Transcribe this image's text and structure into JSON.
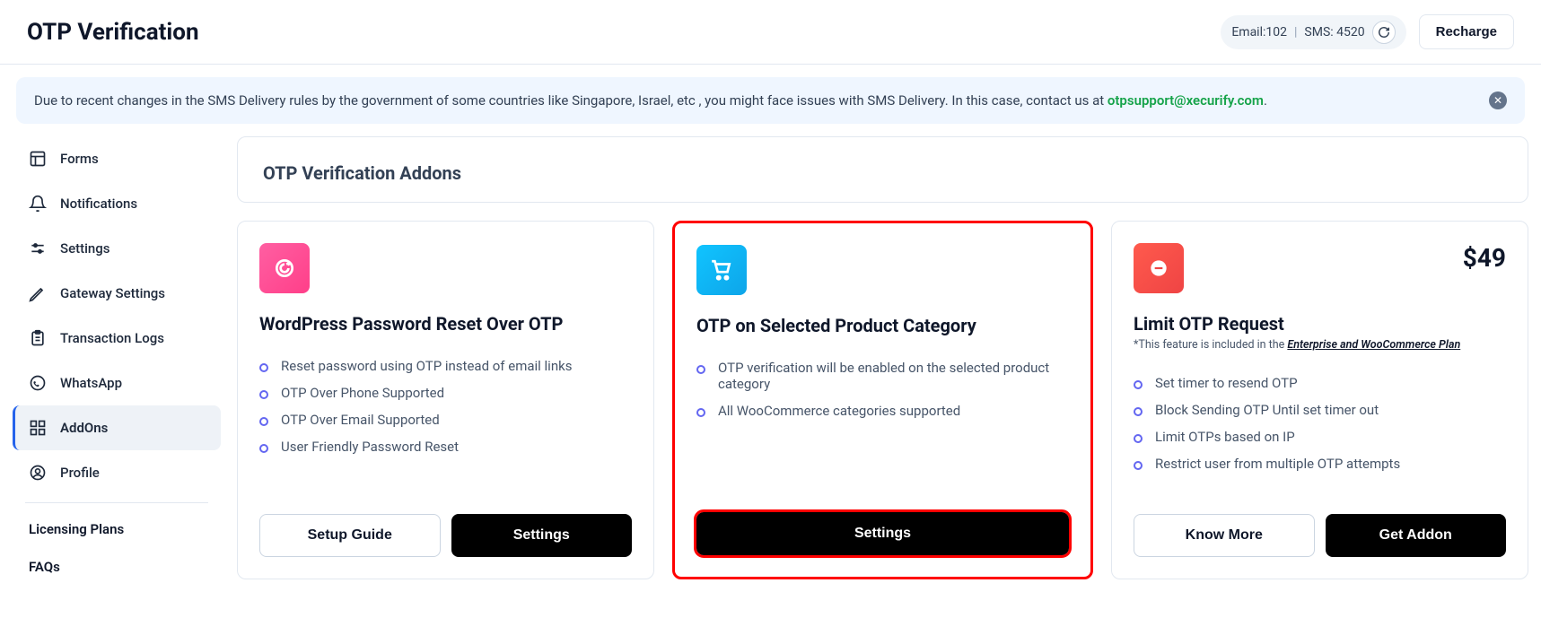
{
  "header": {
    "title": "OTP Verification",
    "email_prefix": "Email:",
    "email_count": "102",
    "sms_prefix": "SMS: ",
    "sms_count": "4520",
    "recharge_label": "Recharge"
  },
  "banner": {
    "text_before": "Due to recent changes in the SMS Delivery rules by the government of some countries like Singapore, Israel, etc , you might face issues with SMS Delivery. In this case, contact us at ",
    "email": "otpsupport@xecurify.com",
    "text_after": "."
  },
  "sidebar": {
    "items": [
      {
        "label": "Forms"
      },
      {
        "label": "Notifications"
      },
      {
        "label": "Settings"
      },
      {
        "label": "Gateway Settings"
      },
      {
        "label": "Transaction Logs"
      },
      {
        "label": "WhatsApp"
      },
      {
        "label": "AddOns"
      },
      {
        "label": "Profile"
      }
    ],
    "extra": [
      {
        "label": "Licensing Plans"
      },
      {
        "label": "FAQs"
      }
    ]
  },
  "panel": {
    "title": "OTP Verification Addons"
  },
  "cards": [
    {
      "title": "WordPress Password Reset Over OTP",
      "features": [
        "Reset password using OTP instead of email links",
        "OTP Over Phone Supported",
        "OTP Over Email Supported",
        "User Friendly Password Reset"
      ],
      "btn1": "Setup Guide",
      "btn2": "Settings"
    },
    {
      "title": "OTP on Selected Product Category",
      "features": [
        "OTP verification will be enabled on the selected product category",
        "All WooCommerce categories supported"
      ],
      "btn2": "Settings"
    },
    {
      "title": "Limit OTP Request",
      "price": "$49",
      "sub_prefix": "*This feature is included in the ",
      "sub_link": "Enterprise and WooCommerce Plan",
      "features": [
        "Set timer to resend OTP",
        "Block Sending OTP Until set timer out",
        "Limit OTPs based on IP",
        "Restrict user from multiple OTP attempts"
      ],
      "btn1": "Know More",
      "btn2": "Get Addon"
    }
  ]
}
